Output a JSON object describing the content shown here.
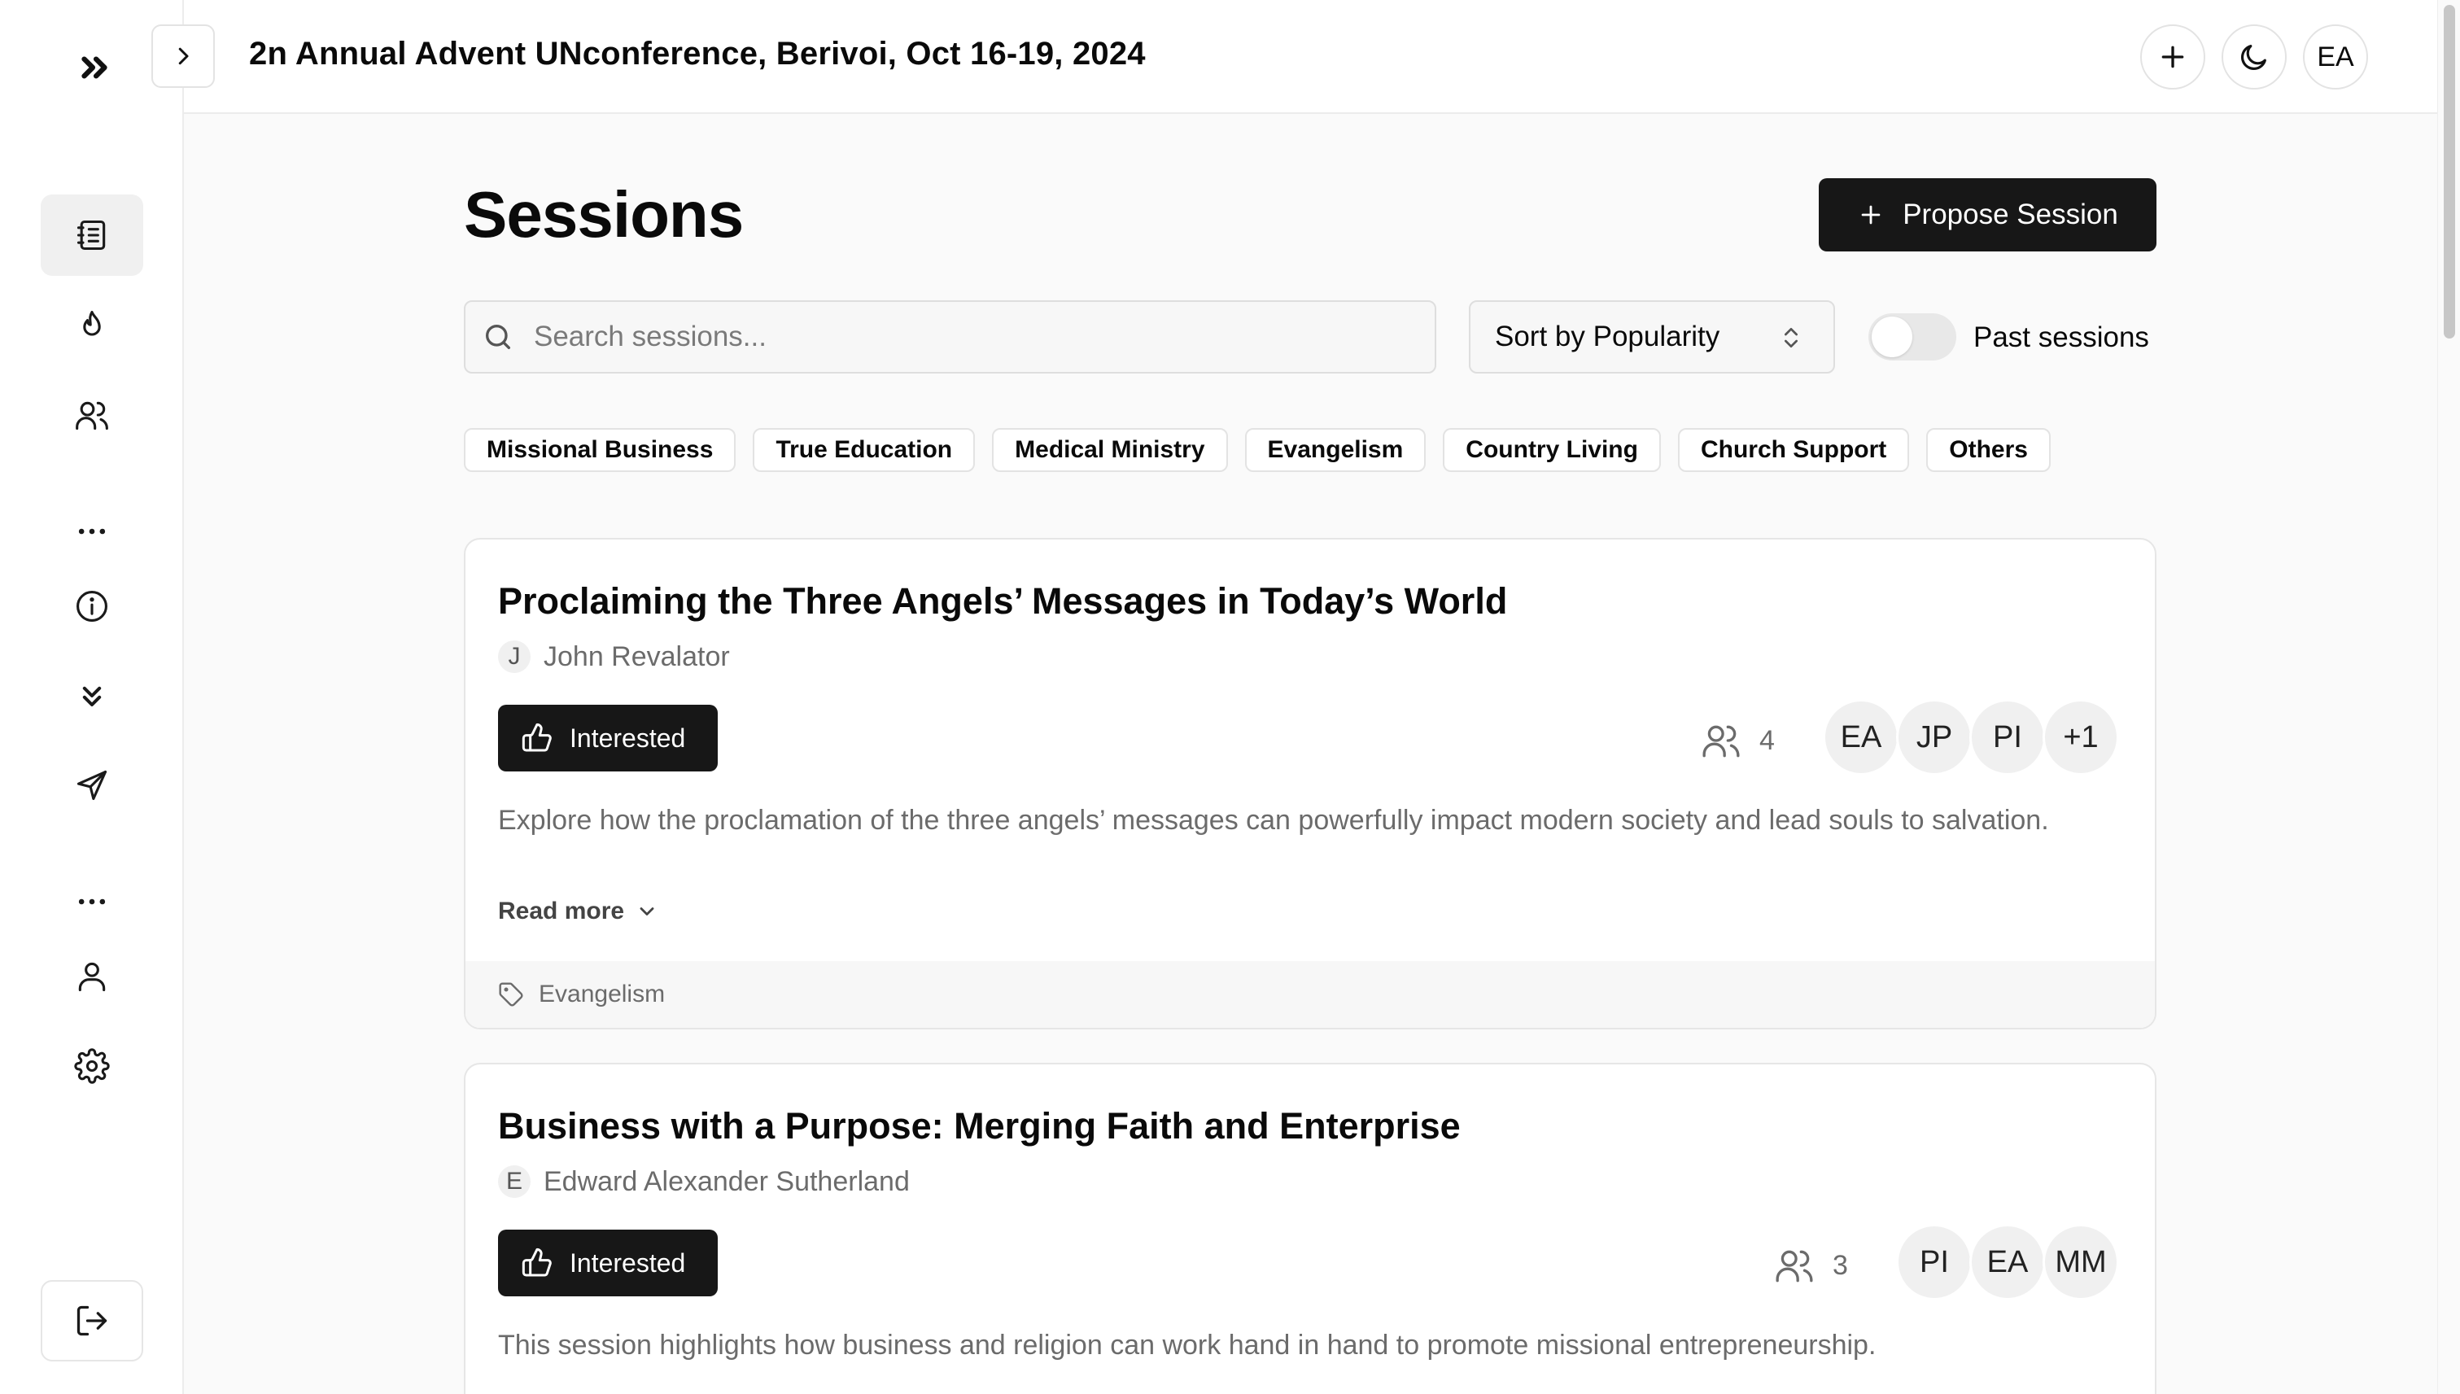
{
  "app": {
    "title": "2n Annual Advent UNconference, Berivoi, Oct 16-19, 2024",
    "user_initials": "EA"
  },
  "sidebar": {
    "items": [
      {
        "icon": "notebook-icon",
        "active": true
      },
      {
        "icon": "flame-icon"
      },
      {
        "icon": "users-icon"
      },
      {
        "icon": "more-horizontal-icon"
      },
      {
        "icon": "info-icon"
      },
      {
        "icon": "chevrons-down-icon"
      },
      {
        "icon": "send-icon"
      },
      {
        "icon": "more-horizontal-icon"
      },
      {
        "icon": "user-icon"
      },
      {
        "icon": "settings-icon"
      }
    ]
  },
  "main": {
    "title": "Sessions",
    "propose_label": "Propose Session",
    "search_placeholder": "Search sessions...",
    "sort_label": "Sort by Popularity",
    "past_sessions_label": "Past sessions",
    "past_sessions_on": false,
    "categories": [
      "Missional Business",
      "True Education",
      "Medical Ministry",
      "Evangelism",
      "Country Living",
      "Church Support",
      "Others"
    ]
  },
  "sessions": [
    {
      "title": "Proclaiming the Three Angels’ Messages in Today’s World",
      "author_initial": "J",
      "author": "John Revalator",
      "interested_label": "Interested",
      "count": "4",
      "avatars": [
        "EA",
        "JP",
        "PI",
        "+1"
      ],
      "description": "Explore how the proclamation of the three angels’ messages can powerfully impact modern society and lead souls to salvation.",
      "read_more": "Read more",
      "tag": "Evangelism"
    },
    {
      "title": "Business with a Purpose: Merging Faith and Enterprise",
      "author_initial": "E",
      "author": "Edward Alexander Sutherland",
      "interested_label": "Interested",
      "count": "3",
      "avatars": [
        "PI",
        "EA",
        "MM"
      ],
      "description": "This session highlights how business and religion can work hand in hand to promote missional entrepreneurship."
    }
  ]
}
